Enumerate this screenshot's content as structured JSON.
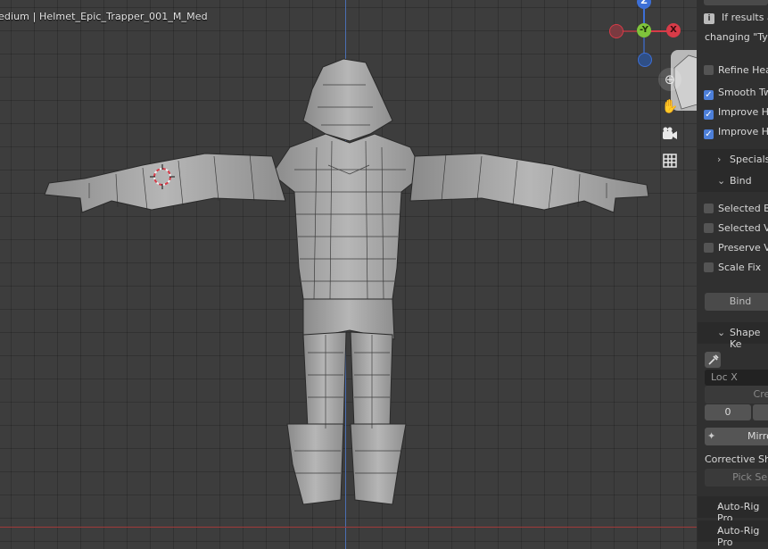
{
  "viewport": {
    "title": "edium | Helmet_Epic_Trapper_001_M_Med",
    "gizmo": {
      "x": "X",
      "y": "-Y",
      "z": "Z"
    },
    "nav_icons": [
      "zoom-icon",
      "hand-pan-icon",
      "camera-icon",
      "grid-icon"
    ]
  },
  "sidebar": {
    "info_line1": "If results a",
    "info_line2": "changing \"Typ",
    "options": [
      {
        "label": "Refine Hea",
        "checked": false
      },
      {
        "label": "Smooth Tw",
        "checked": true
      },
      {
        "label": "Improve Hi",
        "checked": true
      },
      {
        "label": "Improve He",
        "checked": true
      }
    ],
    "specials_label": "Specials",
    "bind_section_label": "Bind",
    "bind_options": [
      {
        "label": "Selected Bo",
        "checked": false
      },
      {
        "label": "Selected Ve",
        "checked": false
      },
      {
        "label": "Preserve Vo",
        "checked": false
      },
      {
        "label": "Scale Fix",
        "checked": false
      }
    ],
    "bind_button": "Bind",
    "shape_keys_label": "Shape Ke",
    "loc_placeholder": "Loc X",
    "create_button": "Crea",
    "value_zero": "0",
    "mirror_button": "Mirro",
    "corrective_label": "Corrective Sha",
    "pick_select_button": "Pick Sele",
    "autorig_1": "Auto-Rig Pro",
    "autorig_2": "Auto-Rig Pro"
  },
  "colors": {
    "viewport_bg": "#3d3d3d",
    "panel_bg": "#303030",
    "checkbox_on": "#4d7fd8",
    "axis_red": "#d83b48",
    "axis_green": "#7fc43b",
    "axis_blue": "#3d6fd6"
  }
}
